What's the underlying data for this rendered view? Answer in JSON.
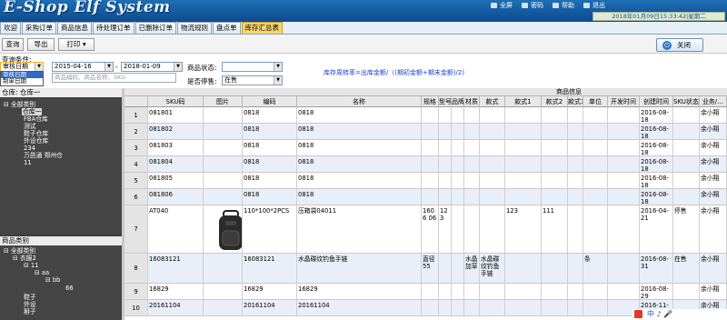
{
  "header": {
    "logo": "E-Shop Elf System",
    "links": [
      "全屏",
      "密码",
      "帮助",
      "退出"
    ],
    "datetime": "2018年01月09日15:33:42|星期二"
  },
  "tabs": [
    "欢迎",
    "采购订单",
    "商品信息",
    "待处理订单",
    "已删除订单",
    "物流规则",
    "盘点单",
    "库存汇总表"
  ],
  "active_tab": "库存汇总表",
  "toolbar": {
    "query_label": "查询",
    "export_label": "导出",
    "print_label": "打印",
    "print_arrow": "▾",
    "close_label": "关闭",
    "close_icon": "power-icon"
  },
  "filters": {
    "query_cond_label": "查询条件:",
    "date_type_value": "审核日期",
    "date_type_options": [
      "审核日期",
      "制单日期"
    ],
    "date_from": "2015-04-16",
    "date_sep": "-",
    "date_to": "2018-01-09",
    "goods_status_label": "商品状态:",
    "goods_status_value": "",
    "stop_label": "是否停售:",
    "stop_value": "在售",
    "search_placeholder": "商品编码、商品名称、SKU",
    "formula": "库存周转率=出库金额/（(期初金额+期末金额)/2)"
  },
  "left_panel": {
    "warehouse_title": "仓库: 仓库一",
    "warehouse_tree": [
      {
        "label": "全部类别",
        "level": 0
      },
      {
        "label": "仓库一",
        "level": 1,
        "selected": true
      },
      {
        "label": "FBA仓库",
        "level": 1
      },
      {
        "label": "测试",
        "level": 1
      },
      {
        "label": "鞋子仓库",
        "level": 1
      },
      {
        "label": "外设仓库",
        "level": 1
      },
      {
        "label": "234",
        "level": 1
      },
      {
        "label": "万邑通  郑州仓",
        "level": 1
      },
      {
        "label": "11",
        "level": 1
      }
    ],
    "category_title": "商品类别",
    "category_tree": [
      {
        "label": "全部类别",
        "level": 0
      },
      {
        "label": "衣服2",
        "level": 1
      },
      {
        "label": "11",
        "level": 2
      },
      {
        "label": "aa",
        "level": 3
      },
      {
        "label": "bb",
        "level": 4
      },
      {
        "label": "66",
        "level": 5
      },
      {
        "label": "鞋子",
        "level": 1
      },
      {
        "label": "外设",
        "level": 1
      },
      {
        "label": "掰子",
        "level": 1
      }
    ]
  },
  "grid": {
    "group_header": "商品信息",
    "columns": [
      "SKU码",
      "图片",
      "编码",
      "名称",
      "规格",
      "型号",
      "品牌",
      "材质",
      "款式",
      "款式1",
      "款式2",
      "款式3",
      "单位",
      "开发时间",
      "创建时间",
      "SKU状态",
      "业务/…"
    ],
    "rows": [
      {
        "n": "1",
        "cells": [
          "081801",
          "",
          "0818",
          "0818",
          "",
          "",
          "",
          "",
          "",
          "",
          "",
          "",
          "",
          "",
          "2016-08-18",
          "",
          "余小翔"
        ]
      },
      {
        "n": "2",
        "cells": [
          "081802",
          "",
          "0818",
          "0818",
          "",
          "",
          "",
          "",
          "",
          "",
          "",
          "",
          "",
          "",
          "2016-08-18",
          "",
          "余小翔"
        ]
      },
      {
        "n": "3",
        "cells": [
          "081803",
          "",
          "0818",
          "0818",
          "",
          "",
          "",
          "",
          "",
          "",
          "",
          "",
          "",
          "",
          "2016-08-18",
          "",
          "余小翔"
        ]
      },
      {
        "n": "4",
        "cells": [
          "081804",
          "",
          "0818",
          "0818",
          "",
          "",
          "",
          "",
          "",
          "",
          "",
          "",
          "",
          "",
          "2016-08-18",
          "",
          "余小翔"
        ]
      },
      {
        "n": "5",
        "cells": [
          "081805",
          "",
          "0818",
          "0818",
          "",
          "",
          "",
          "",
          "",
          "",
          "",
          "",
          "",
          "",
          "2016-08-18",
          "",
          "余小翔"
        ]
      },
      {
        "n": "6",
        "cells": [
          "081806",
          "",
          "0818",
          "0818",
          "",
          "",
          "",
          "",
          "",
          "",
          "",
          "",
          "",
          "",
          "2016-08-18",
          "",
          "余小翔"
        ]
      },
      {
        "n": "7",
        "cells": [
          "AT040",
          "",
          "110*100*2PCS",
          "压箱袋04011",
          "1606 06",
          "123",
          "",
          "",
          "",
          "123",
          "111",
          "",
          "",
          "",
          "2016-04-21",
          "停售",
          "余小翔"
        ],
        "image": "backpack-thumbnail"
      },
      {
        "n": "8",
        "cells": [
          "16083121",
          "",
          "16083121",
          "水晶碟纹钓鱼手链",
          "直径 55",
          "",
          "",
          "水晶加草",
          "水晶碟纹钓鱼手链",
          "",
          "",
          "",
          "条",
          "",
          "2016-08-31",
          "在售",
          "余小翔"
        ]
      },
      {
        "n": "9",
        "cells": [
          "16829",
          "",
          "16829",
          "16829",
          "",
          "",
          "",
          "",
          "",
          "",
          "",
          "",
          "",
          "",
          "2016-08-29",
          "",
          "余小翔"
        ]
      },
      {
        "n": "10",
        "cells": [
          "20161104",
          "",
          "20161104",
          "20161104",
          "",
          "",
          "",
          "",
          "",
          "",
          "",
          "",
          "",
          "",
          "2016-11-04",
          "",
          "余小翔"
        ]
      }
    ]
  },
  "corner_ad": "中 ♪ 🎤"
}
